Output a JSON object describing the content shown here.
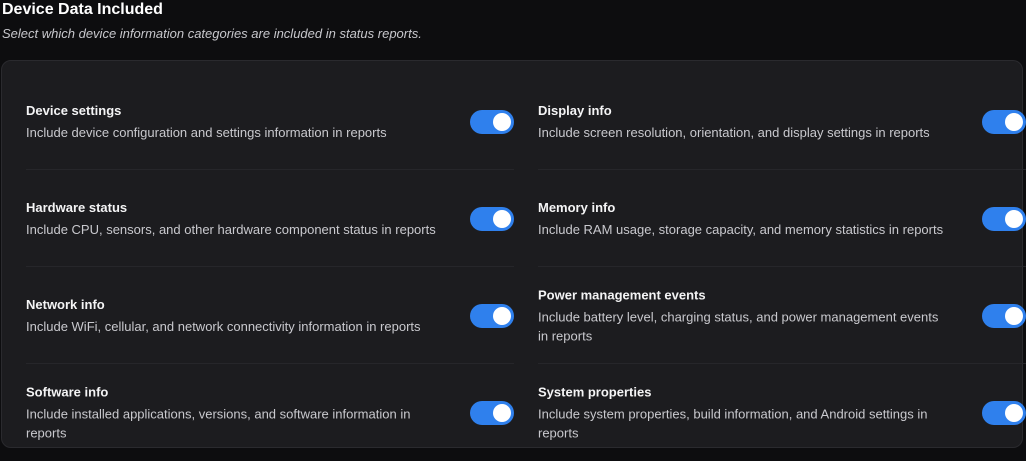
{
  "header": {
    "title": "Device Data Included",
    "subtitle": "Select which device information categories are included in status reports."
  },
  "accent_color": "#2f80ed",
  "settings": [
    {
      "label": "Device settings",
      "description": "Include device configuration and settings information in reports",
      "enabled": true
    },
    {
      "label": "Display info",
      "description": "Include screen resolution, orientation, and display settings in reports",
      "enabled": true
    },
    {
      "label": "Hardware status",
      "description": "Include CPU, sensors, and other hardware component status in reports",
      "enabled": true
    },
    {
      "label": "Memory info",
      "description": "Include RAM usage, storage capacity, and memory statistics in reports",
      "enabled": true
    },
    {
      "label": "Network info",
      "description": "Include WiFi, cellular, and network connectivity information in reports",
      "enabled": true
    },
    {
      "label": "Power management events",
      "description": "Include battery level, charging status, and power management events in reports",
      "enabled": true
    },
    {
      "label": "Software info",
      "description": "Include installed applications, versions, and software information in reports",
      "enabled": true
    },
    {
      "label": "System properties",
      "description": "Include system properties, build information, and Android settings in reports",
      "enabled": true
    }
  ]
}
